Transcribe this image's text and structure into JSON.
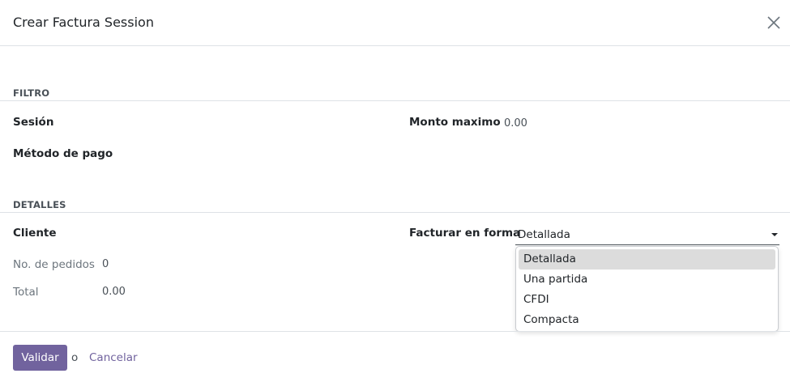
{
  "dialog": {
    "title": "Crear Factura Session"
  },
  "filtro": {
    "section_title": "FILTRO",
    "sesion_label": "Sesión",
    "metodo_pago_label": "Método de pago",
    "monto_maximo_label": "Monto maximo",
    "monto_maximo_value": "0.00"
  },
  "detalles": {
    "section_title": "DETALLES",
    "cliente_label": "Cliente",
    "pedidos_label": "No. de pedidos",
    "pedidos_value": "0",
    "total_label": "Total",
    "total_value": "0.00",
    "facturar_label": "Facturar en forma",
    "facturar_value": "Detallada",
    "facturar_options": [
      "Detallada",
      "Una partida",
      "CFDI",
      "Compacta"
    ]
  },
  "footer": {
    "validar_label": "Validar",
    "or_text": "o",
    "cancelar_label": "Cancelar"
  },
  "colors": {
    "primary": "#71639e",
    "border": "#dee2e6",
    "option_highlight": "#dcdcdc"
  },
  "icons": {
    "close": "close-icon",
    "caret": "chevron-down-icon"
  }
}
